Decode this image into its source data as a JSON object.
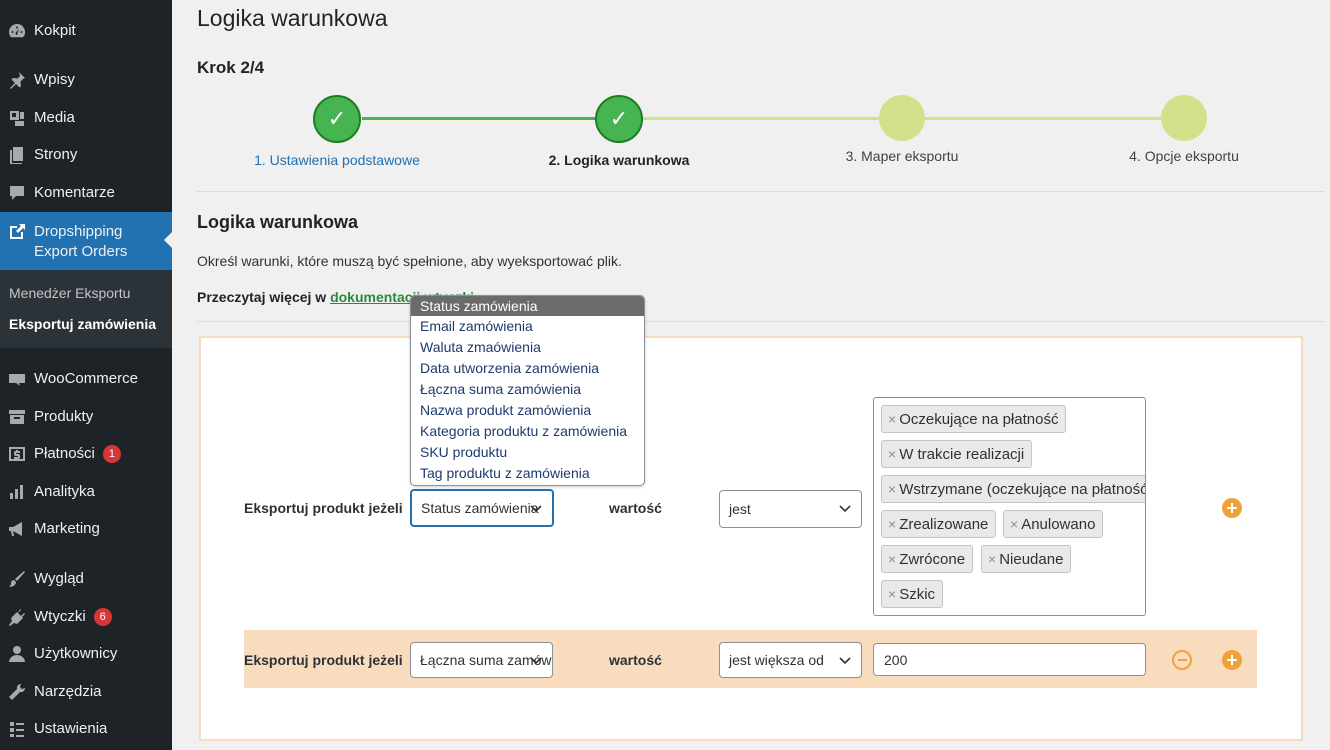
{
  "sidebar": {
    "items": [
      {
        "label": "Kokpit",
        "icon": "dashboard-icon"
      },
      {
        "label": "Wpisy",
        "icon": "pin-icon"
      },
      {
        "label": "Media",
        "icon": "media-icon"
      },
      {
        "label": "Strony",
        "icon": "pages-icon"
      },
      {
        "label": "Komentarze",
        "icon": "comments-icon"
      },
      {
        "label": "Dropshipping",
        "label2": "Export Orders",
        "icon": "external-link-icon"
      },
      {
        "label": "WooCommerce",
        "icon": "woo-icon"
      },
      {
        "label": "Produkty",
        "icon": "archive-icon"
      },
      {
        "label": "Płatności",
        "icon": "dollar-icon",
        "badge": "1"
      },
      {
        "label": "Analityka",
        "icon": "bar-chart-icon"
      },
      {
        "label": "Marketing",
        "icon": "megaphone-icon"
      },
      {
        "label": "Wygląd",
        "icon": "brush-icon"
      },
      {
        "label": "Wtyczki",
        "icon": "plug-icon",
        "badge": "6"
      },
      {
        "label": "Użytkownicy",
        "icon": "user-icon"
      },
      {
        "label": "Narzędzia",
        "icon": "wrench-icon"
      },
      {
        "label": "Ustawienia",
        "icon": "settings-icon"
      }
    ],
    "submenu": [
      "Menedżer Eksportu",
      "Eksportuj zamówienia"
    ]
  },
  "page": {
    "title": "Logika warunkowa",
    "step": "Krok 2/4"
  },
  "steps": [
    {
      "label": "1. Ustawienia podstawowe",
      "check": "✓"
    },
    {
      "label": "2. Logika warunkowa",
      "check": "✓"
    },
    {
      "label": "3. Maper eksportu"
    },
    {
      "label": "4. Opcje eksportu"
    }
  ],
  "section": {
    "title": "Logika warunkowa",
    "description": "Określ warunki, które muszą być spełnione, aby wyeksportować plik.",
    "read_more": "Przeczytaj więcej w",
    "doc_link": "dokumentacji wtyczki"
  },
  "rows": [
    {
      "label": "Eksportuj produkt jeżeli",
      "field": "Status zamówienia",
      "value_label": "wartość",
      "operator": "jest",
      "tags": [
        "Oczekujące na płatność",
        "W trakcie realizacji",
        "Wstrzymane (oczekujące na płatność)",
        "Zrealizowane",
        "Anulowano",
        "Zwrócone",
        "Nieudane",
        "Szkic"
      ]
    },
    {
      "label": "Eksportuj produkt jeżeli",
      "field": "Łączna suma zamówienia",
      "value_label": "wartość",
      "operator": "jest większa od",
      "value": "200"
    }
  ],
  "dropdown_options": [
    "Status zamówienia",
    "Email zamówienia",
    "Waluta zmaówienia",
    "Data utworzenia zamówienia",
    "Łączna suma zamówienia",
    "Nazwa produkt zamówienia",
    "Kategoria produktu z zamówienia",
    "SKU produktu",
    "Tag produktu z zamówienia"
  ],
  "colors": {
    "sidebar": "#1d2327",
    "active": "#2271b1",
    "step_done": "#46b450",
    "step_todo": "#d5e08a",
    "accent": "#f0a23a"
  }
}
